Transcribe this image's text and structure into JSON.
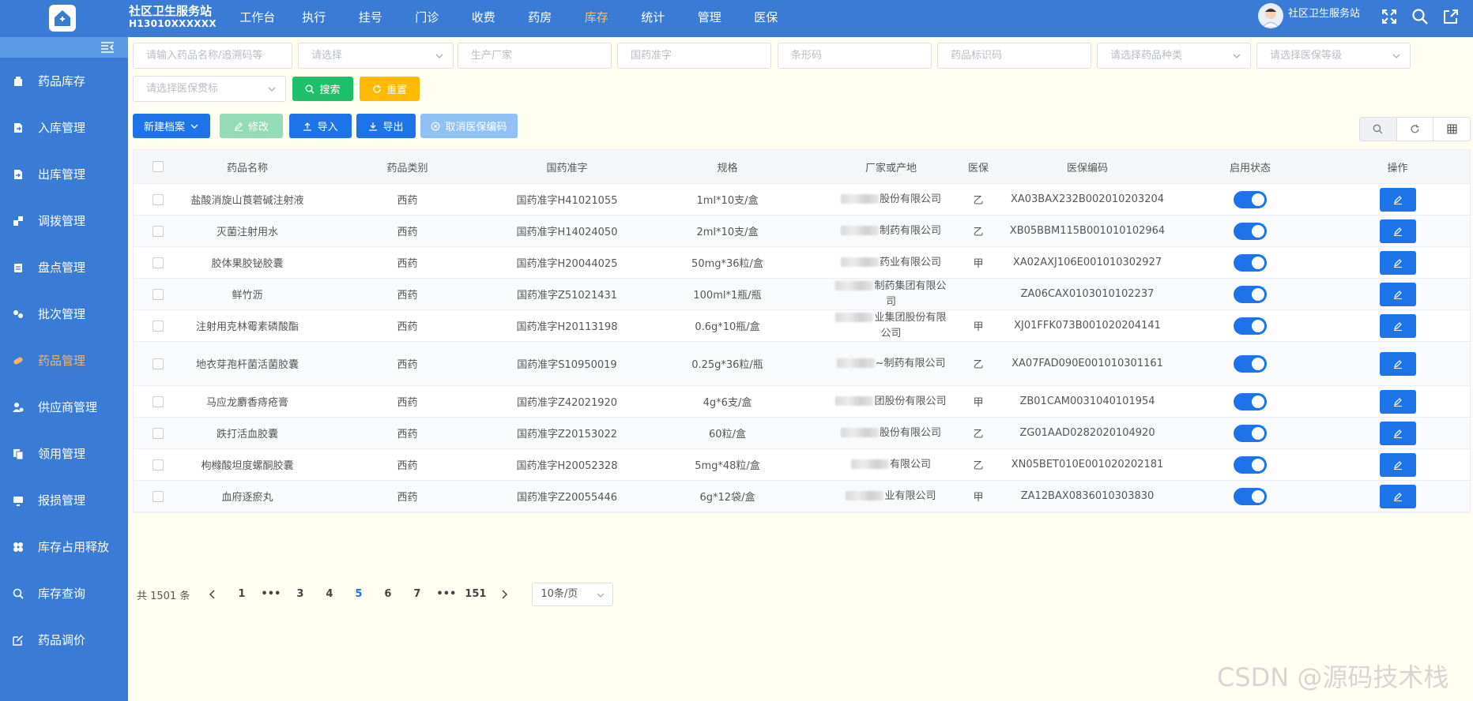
{
  "app": {
    "org_name": "社区卫生服务站",
    "org_code": "H13010XXXXXX",
    "user_name": "社区卫生服务站"
  },
  "nav": {
    "items": [
      "工作台",
      "执行",
      "挂号",
      "门诊",
      "收费",
      "药房",
      "库存",
      "统计",
      "管理",
      "医保"
    ],
    "active": "库存"
  },
  "sidebar": {
    "items": [
      {
        "label": "药品库存",
        "icon": "box-icon"
      },
      {
        "label": "入库管理",
        "icon": "import-icon"
      },
      {
        "label": "出库管理",
        "icon": "export-icon"
      },
      {
        "label": "调拨管理",
        "icon": "transfer-icon"
      },
      {
        "label": "盘点管理",
        "icon": "clipboard-icon"
      },
      {
        "label": "批次管理",
        "icon": "batch-icon"
      },
      {
        "label": "药品管理",
        "icon": "pill-icon"
      },
      {
        "label": "供应商管理",
        "icon": "supplier-icon"
      },
      {
        "label": "领用管理",
        "icon": "copy-icon"
      },
      {
        "label": "报损管理",
        "icon": "monitor-icon"
      },
      {
        "label": "库存占用释放",
        "icon": "grid-icon"
      },
      {
        "label": "库存查询",
        "icon": "search-stock-icon"
      },
      {
        "label": "药品调价",
        "icon": "edit-price-icon"
      }
    ],
    "active": "药品管理"
  },
  "filters": {
    "name_placeholder": "请输入药品名称/追溯码等",
    "type_placeholder": "请选择",
    "maker_placeholder": "生产厂家",
    "approval_placeholder": "国药准字",
    "barcode_placeholder": "条形码",
    "drugid_placeholder": "药品标识码",
    "category_placeholder": "请选择药品种类",
    "level_placeholder": "请选择医保等级",
    "mark_placeholder": "请选择医保贯标",
    "search_label": "搜索",
    "reset_label": "重置"
  },
  "toolbar": {
    "new_label": "新建档案",
    "edit_label": "修改",
    "import_label": "导入",
    "export_label": "导出",
    "cancel_code_label": "取消医保编码"
  },
  "table": {
    "headers": [
      "药品名称",
      "药品类别",
      "国药准字",
      "规格",
      "厂家或产地",
      "医保",
      "医保编码",
      "启用状态",
      "操作"
    ],
    "rows": [
      {
        "name": "盐酸消旋山莨菪碱注射液",
        "type": "西药",
        "approval": "国药准字H41021055",
        "spec": "1ml*10支/盒",
        "maker": "股份有限公司",
        "level": "乙",
        "code": "XA03BAX232B002010203204",
        "enabled": true
      },
      {
        "name": "灭菌注射用水",
        "type": "西药",
        "approval": "国药准字H14024050",
        "spec": "2ml*10支/盒",
        "maker": "制药有限公司",
        "level": "乙",
        "code": "XB05BBM115B001010102964",
        "enabled": true
      },
      {
        "name": "胶体果胶铋胶囊",
        "type": "西药",
        "approval": "国药准字H20044025",
        "spec": "50mg*36粒/盒",
        "maker": "药业有限公司",
        "level": "甲",
        "code": "XA02AXJ106E001010302927",
        "enabled": true
      },
      {
        "name": "鲜竹沥",
        "type": "西药",
        "approval": "国药准字Z51021431",
        "spec": "100ml*1瓶/瓶",
        "maker": "制药集团有限公司",
        "level": "",
        "code": "ZA06CAX0103010102237",
        "enabled": true
      },
      {
        "name": "注射用克林霉素磷酸酯",
        "type": "西药",
        "approval": "国药准字H20113198",
        "spec": "0.6g*10瓶/盒",
        "maker": "业集团股份有限公司",
        "level": "甲",
        "code": "XJ01FFK073B001020204141",
        "enabled": true
      },
      {
        "name": "地衣芽孢杆菌活菌胶囊",
        "type": "西药",
        "approval": "国药准字S10950019",
        "spec": "0.25g*36粒/瓶",
        "maker": "~制药有限公司",
        "level": "乙",
        "code": "XA07FAD090E001010301161",
        "enabled": true
      },
      {
        "name": "马应龙麝香痔疮膏",
        "type": "西药",
        "approval": "国药准字Z42021920",
        "spec": "4g*6支/盒",
        "maker": "团股份有限公司",
        "level": "甲",
        "code": "ZB01CAM0031040101954",
        "enabled": true
      },
      {
        "name": "跌打活血胶囊",
        "type": "西药",
        "approval": "国药准字Z20153022",
        "spec": "60粒/盒",
        "maker": "股份有限公司",
        "level": "乙",
        "code": "ZG01AAD0282020104920",
        "enabled": true
      },
      {
        "name": "枸橼酸坦度螺酮胶囊",
        "type": "西药",
        "approval": "国药准字H20052328",
        "spec": "5mg*48粒/盒",
        "maker": "有限公司",
        "level": "乙",
        "code": "XN05BET010E001020202181",
        "enabled": true
      },
      {
        "name": "血府逐瘀丸",
        "type": "西药",
        "approval": "国药准字Z20055446",
        "spec": "6g*12袋/盒",
        "maker": "业有限公司",
        "level": "甲",
        "code": "ZA12BAX0836010303830",
        "enabled": true
      }
    ]
  },
  "pager": {
    "total": "共 1501 条",
    "pages": [
      "1",
      "•••",
      "3",
      "4",
      "5",
      "6",
      "7",
      "•••",
      "151"
    ],
    "current": "5",
    "size": "10条/页"
  },
  "watermark": "CSDN @源码技术栈",
  "colors": {
    "primary": "#3a7bd5",
    "accent": "#f0b56a",
    "blue": "#1d73e8",
    "green": "#1fc06b",
    "orange": "#ffba00"
  }
}
